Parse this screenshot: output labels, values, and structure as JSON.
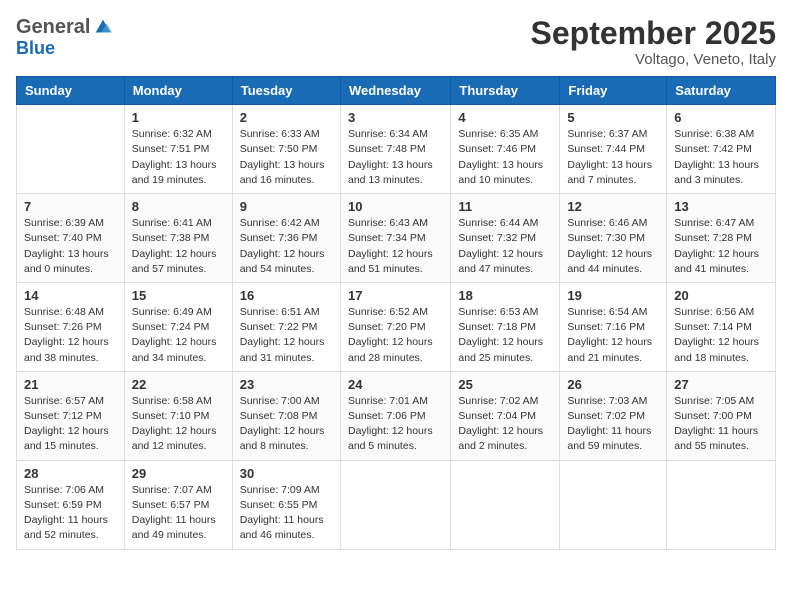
{
  "header": {
    "logo_general": "General",
    "logo_blue": "Blue",
    "month_title": "September 2025",
    "location": "Voltago, Veneto, Italy"
  },
  "days_of_week": [
    "Sunday",
    "Monday",
    "Tuesday",
    "Wednesday",
    "Thursday",
    "Friday",
    "Saturday"
  ],
  "weeks": [
    [
      {
        "day": "",
        "info": ""
      },
      {
        "day": "1",
        "info": "Sunrise: 6:32 AM\nSunset: 7:51 PM\nDaylight: 13 hours\nand 19 minutes."
      },
      {
        "day": "2",
        "info": "Sunrise: 6:33 AM\nSunset: 7:50 PM\nDaylight: 13 hours\nand 16 minutes."
      },
      {
        "day": "3",
        "info": "Sunrise: 6:34 AM\nSunset: 7:48 PM\nDaylight: 13 hours\nand 13 minutes."
      },
      {
        "day": "4",
        "info": "Sunrise: 6:35 AM\nSunset: 7:46 PM\nDaylight: 13 hours\nand 10 minutes."
      },
      {
        "day": "5",
        "info": "Sunrise: 6:37 AM\nSunset: 7:44 PM\nDaylight: 13 hours\nand 7 minutes."
      },
      {
        "day": "6",
        "info": "Sunrise: 6:38 AM\nSunset: 7:42 PM\nDaylight: 13 hours\nand 3 minutes."
      }
    ],
    [
      {
        "day": "7",
        "info": "Sunrise: 6:39 AM\nSunset: 7:40 PM\nDaylight: 13 hours\nand 0 minutes."
      },
      {
        "day": "8",
        "info": "Sunrise: 6:41 AM\nSunset: 7:38 PM\nDaylight: 12 hours\nand 57 minutes."
      },
      {
        "day": "9",
        "info": "Sunrise: 6:42 AM\nSunset: 7:36 PM\nDaylight: 12 hours\nand 54 minutes."
      },
      {
        "day": "10",
        "info": "Sunrise: 6:43 AM\nSunset: 7:34 PM\nDaylight: 12 hours\nand 51 minutes."
      },
      {
        "day": "11",
        "info": "Sunrise: 6:44 AM\nSunset: 7:32 PM\nDaylight: 12 hours\nand 47 minutes."
      },
      {
        "day": "12",
        "info": "Sunrise: 6:46 AM\nSunset: 7:30 PM\nDaylight: 12 hours\nand 44 minutes."
      },
      {
        "day": "13",
        "info": "Sunrise: 6:47 AM\nSunset: 7:28 PM\nDaylight: 12 hours\nand 41 minutes."
      }
    ],
    [
      {
        "day": "14",
        "info": "Sunrise: 6:48 AM\nSunset: 7:26 PM\nDaylight: 12 hours\nand 38 minutes."
      },
      {
        "day": "15",
        "info": "Sunrise: 6:49 AM\nSunset: 7:24 PM\nDaylight: 12 hours\nand 34 minutes."
      },
      {
        "day": "16",
        "info": "Sunrise: 6:51 AM\nSunset: 7:22 PM\nDaylight: 12 hours\nand 31 minutes."
      },
      {
        "day": "17",
        "info": "Sunrise: 6:52 AM\nSunset: 7:20 PM\nDaylight: 12 hours\nand 28 minutes."
      },
      {
        "day": "18",
        "info": "Sunrise: 6:53 AM\nSunset: 7:18 PM\nDaylight: 12 hours\nand 25 minutes."
      },
      {
        "day": "19",
        "info": "Sunrise: 6:54 AM\nSunset: 7:16 PM\nDaylight: 12 hours\nand 21 minutes."
      },
      {
        "day": "20",
        "info": "Sunrise: 6:56 AM\nSunset: 7:14 PM\nDaylight: 12 hours\nand 18 minutes."
      }
    ],
    [
      {
        "day": "21",
        "info": "Sunrise: 6:57 AM\nSunset: 7:12 PM\nDaylight: 12 hours\nand 15 minutes."
      },
      {
        "day": "22",
        "info": "Sunrise: 6:58 AM\nSunset: 7:10 PM\nDaylight: 12 hours\nand 12 minutes."
      },
      {
        "day": "23",
        "info": "Sunrise: 7:00 AM\nSunset: 7:08 PM\nDaylight: 12 hours\nand 8 minutes."
      },
      {
        "day": "24",
        "info": "Sunrise: 7:01 AM\nSunset: 7:06 PM\nDaylight: 12 hours\nand 5 minutes."
      },
      {
        "day": "25",
        "info": "Sunrise: 7:02 AM\nSunset: 7:04 PM\nDaylight: 12 hours\nand 2 minutes."
      },
      {
        "day": "26",
        "info": "Sunrise: 7:03 AM\nSunset: 7:02 PM\nDaylight: 11 hours\nand 59 minutes."
      },
      {
        "day": "27",
        "info": "Sunrise: 7:05 AM\nSunset: 7:00 PM\nDaylight: 11 hours\nand 55 minutes."
      }
    ],
    [
      {
        "day": "28",
        "info": "Sunrise: 7:06 AM\nSunset: 6:59 PM\nDaylight: 11 hours\nand 52 minutes."
      },
      {
        "day": "29",
        "info": "Sunrise: 7:07 AM\nSunset: 6:57 PM\nDaylight: 11 hours\nand 49 minutes."
      },
      {
        "day": "30",
        "info": "Sunrise: 7:09 AM\nSunset: 6:55 PM\nDaylight: 11 hours\nand 46 minutes."
      },
      {
        "day": "",
        "info": ""
      },
      {
        "day": "",
        "info": ""
      },
      {
        "day": "",
        "info": ""
      },
      {
        "day": "",
        "info": ""
      }
    ]
  ]
}
